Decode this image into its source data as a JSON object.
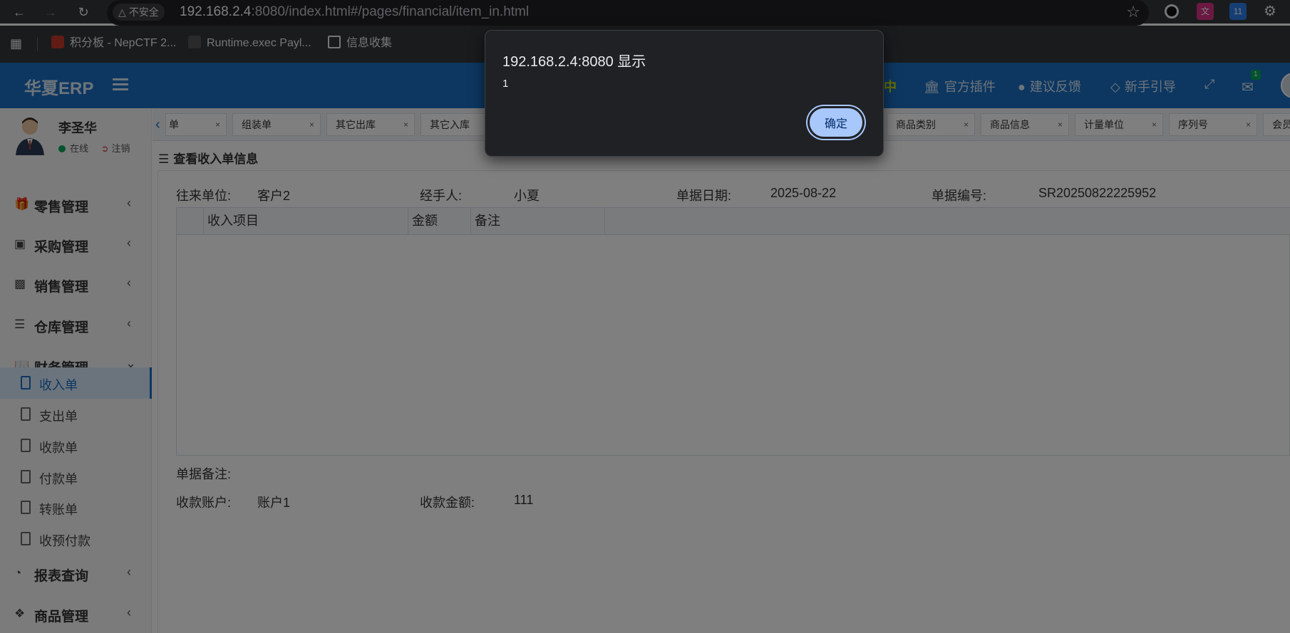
{
  "browser": {
    "security_label": "不安全",
    "url_host": "192.168.2.4",
    "url_rest": ":8080/index.html#/pages/financial/item_in.html",
    "extension_badge": "11",
    "bookmarks": [
      "积分板 - NepCTF 2...",
      "Runtime.exec Payl...",
      "信息收集"
    ]
  },
  "header": {
    "logo": "华夏ERP",
    "partial_item": "中",
    "items": [
      "官方插件",
      "建议反馈",
      "新手引导"
    ],
    "mail_count": "1"
  },
  "user": {
    "name": "李圣华",
    "online": "在线",
    "logout": "注销"
  },
  "sidebar": {
    "menus": [
      {
        "label": "零售管理"
      },
      {
        "label": "采购管理"
      },
      {
        "label": "销售管理"
      },
      {
        "label": "仓库管理"
      },
      {
        "label": "财务管理"
      },
      {
        "label": "报表查询"
      },
      {
        "label": "商品管理"
      }
    ],
    "finance_items": [
      "收入单",
      "支出单",
      "收款单",
      "付款单",
      "转账单",
      "收预付款"
    ]
  },
  "tabs": [
    "单",
    "组装单",
    "其它出库",
    "其它入库",
    "商品类别",
    "商品信息",
    "计量单位",
    "序列号",
    "会员"
  ],
  "content": {
    "title": "查看收入单信息",
    "partner_label": "往来单位:",
    "partner_value": "客户2",
    "handler_label": "经手人:",
    "handler_value": "小夏",
    "date_label": "单据日期:",
    "date_value": "2025-08-22",
    "number_label": "单据编号:",
    "number_value": "SR20250822225952",
    "grid_columns": [
      "收入项目",
      "金额",
      "备注"
    ],
    "remark_label": "单据备注:",
    "account_label": "收款账户:",
    "account_value": "账户1",
    "amount_label": "收款金额:",
    "amount_value": "111"
  },
  "dialog": {
    "title": "192.168.2.4:8080 显示",
    "message": "1",
    "ok_label": "确定"
  },
  "colors": {
    "brand": "#1b6fc2",
    "dialog_button": "#a8c7fa"
  }
}
